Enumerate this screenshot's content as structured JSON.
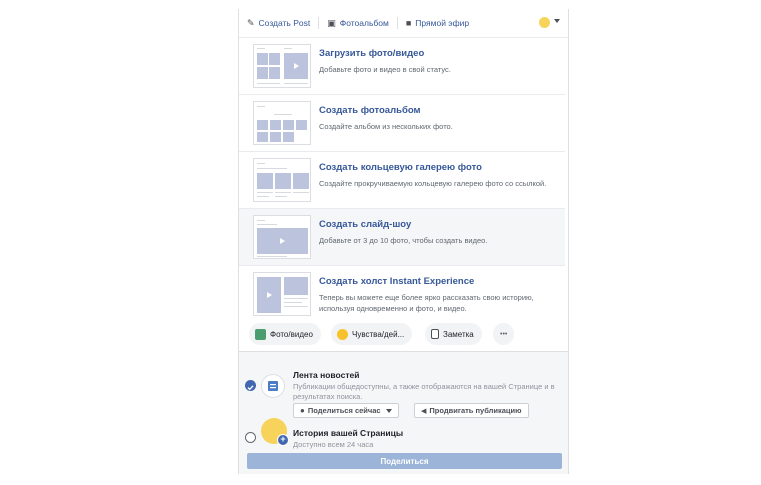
{
  "topbar": {
    "create_post": "Создать Post",
    "photo_album": "Фотоальбом",
    "live": "Прямой эфир"
  },
  "options": [
    {
      "title": "Загрузить фото/видео",
      "desc": "Добавьте фото и видео в свой статус."
    },
    {
      "title": "Создать фотоальбом",
      "desc": "Создайте альбом из нескольких фото."
    },
    {
      "title": "Создать кольцевую галерею фото",
      "desc": "Создайте прокручиваемую кольцевую галерею фото со ссылкой."
    },
    {
      "title": "Создать слайд-шоу",
      "desc": "Добавьте от 3 до 10 фото, чтобы создать видео."
    },
    {
      "title": "Создать холст Instant Experience",
      "desc": "Теперь вы можете еще более ярко рассказать свою историю, используя одновременно и фото, и видео."
    }
  ],
  "chips": {
    "photo_video": "Фото/видео",
    "feelings": "Чувства/дей...",
    "note": "Заметка",
    "more": "•••"
  },
  "feed": {
    "title": "Лента новостей",
    "desc": "Публикации общедоступны, а также отображаются на вашей Странице и в результатах поиска.",
    "share_now": "Поделиться сейчас",
    "promote": "Продвигать публикацию"
  },
  "story": {
    "title": "История вашей Страницы",
    "desc": "Доступно всем 24 часа"
  },
  "share_button": "Поделиться",
  "colors": {
    "link": "#365899",
    "accent": "#4267b2",
    "share_disabled": "#9cb4d8"
  }
}
